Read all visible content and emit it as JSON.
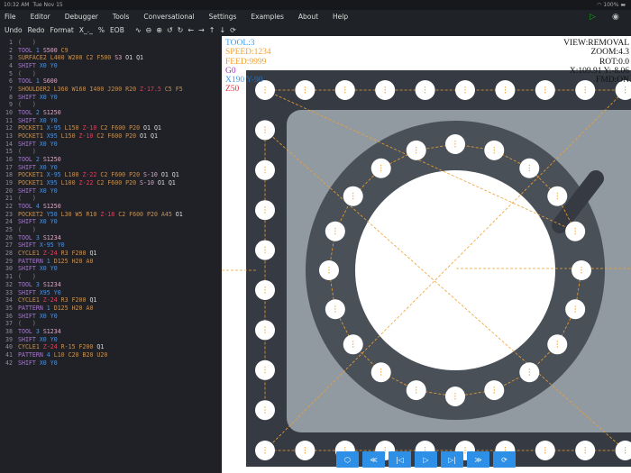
{
  "status": {
    "time": "10:32 AM",
    "date": "Tue Nov 15",
    "battery": "100%"
  },
  "menu": [
    "File",
    "Editor",
    "Debugger",
    "Tools",
    "Conversational",
    "Settings",
    "Examples",
    "About",
    "Help"
  ],
  "toolbar": {
    "undo": "Undo",
    "redo": "Redo",
    "format": "Format",
    "x": "X_._",
    "percent": "%",
    "eob": "EOB"
  },
  "code": [
    "(   )",
    "TOOL 1 S500 C9",
    "SURFACE2 L400 W200 C2 F500 S3 O1 Q1",
    "SHIFT X0 Y0",
    "(   )",
    "TOOL 1 S600",
    "SHOULDER2 L360 W160 I400 J200 R20 Z-17.5 C5 F5",
    "SHIFT X0 Y0",
    "(   )",
    "TOOL 2 S1250",
    "SHIFT X0 Y0",
    "POCKET1 X-95 L150 Z-10 C2 F600 P20 O1 Q1",
    "POCKET1 X95 L150 Z-10 C2 F600 P20 O1 Q1",
    "SHIFT X0 Y0",
    "(   )",
    "TOOL 2 S1250",
    "SHIFT X0 Y0",
    "POCKET1 X-95 L100 Z-22 C2 F600 P20 S-10 O1 Q1",
    "POCKET1 X95 L100 Z-22 C2 F600 P20 S-10 O1 Q1",
    "SHIFT X0 Y0",
    "(   )",
    "TOOL 4 S1250",
    "POCKET2 Y50 L30 W5 R10 Z-18 C2 F600 P20 A45 O1",
    "SHIFT X0 Y0",
    "(   )",
    "TOOL 3 S1234",
    "SHIFT X-95 Y0",
    "CYCLE1 Z-24 R3 F200 Q1",
    "PATTERN 1 D125 H20 A0",
    "SHIFT X0 Y0",
    "(   )",
    "TOOL 3 S1234",
    "SHIFT X95 Y0",
    "CYCLE1 Z-24 R3 F200 Q1",
    "PATTERN 1 D125 H20 A0",
    "SHIFT X0 Y0",
    "(   )",
    "TOOL 3 S1234",
    "SHIFT X0 Y0",
    "CYCLE1 Z-24 R-15 F200 Q1",
    "PATTERN 4 L10 C20 B20 U20",
    "SHIFT X0 Y0"
  ],
  "overlay_left": {
    "tool": "TOOL:3",
    "speed": "SPEED:1234",
    "feed": "FEED:9999",
    "g": "G0",
    "xy_x": "X190",
    "xy_y": "Y-90",
    "z": "Z50"
  },
  "overlay_right": {
    "view": "VIEW:REMOVAL",
    "zoom": "ZOOM:4.3",
    "rot": "ROT:0.0",
    "coords": "X:109.91 Y:-8.06",
    "fmd": "FMD:ON"
  },
  "colors": {
    "tool": "#3f9be8",
    "speed": "#f0a030",
    "g": "#a030c0",
    "z": "#e03040",
    "accent": "#2d8fe6"
  },
  "controls": [
    "3d-view",
    "rewind",
    "step-back",
    "play",
    "step-forward",
    "fast-forward",
    "reset"
  ]
}
